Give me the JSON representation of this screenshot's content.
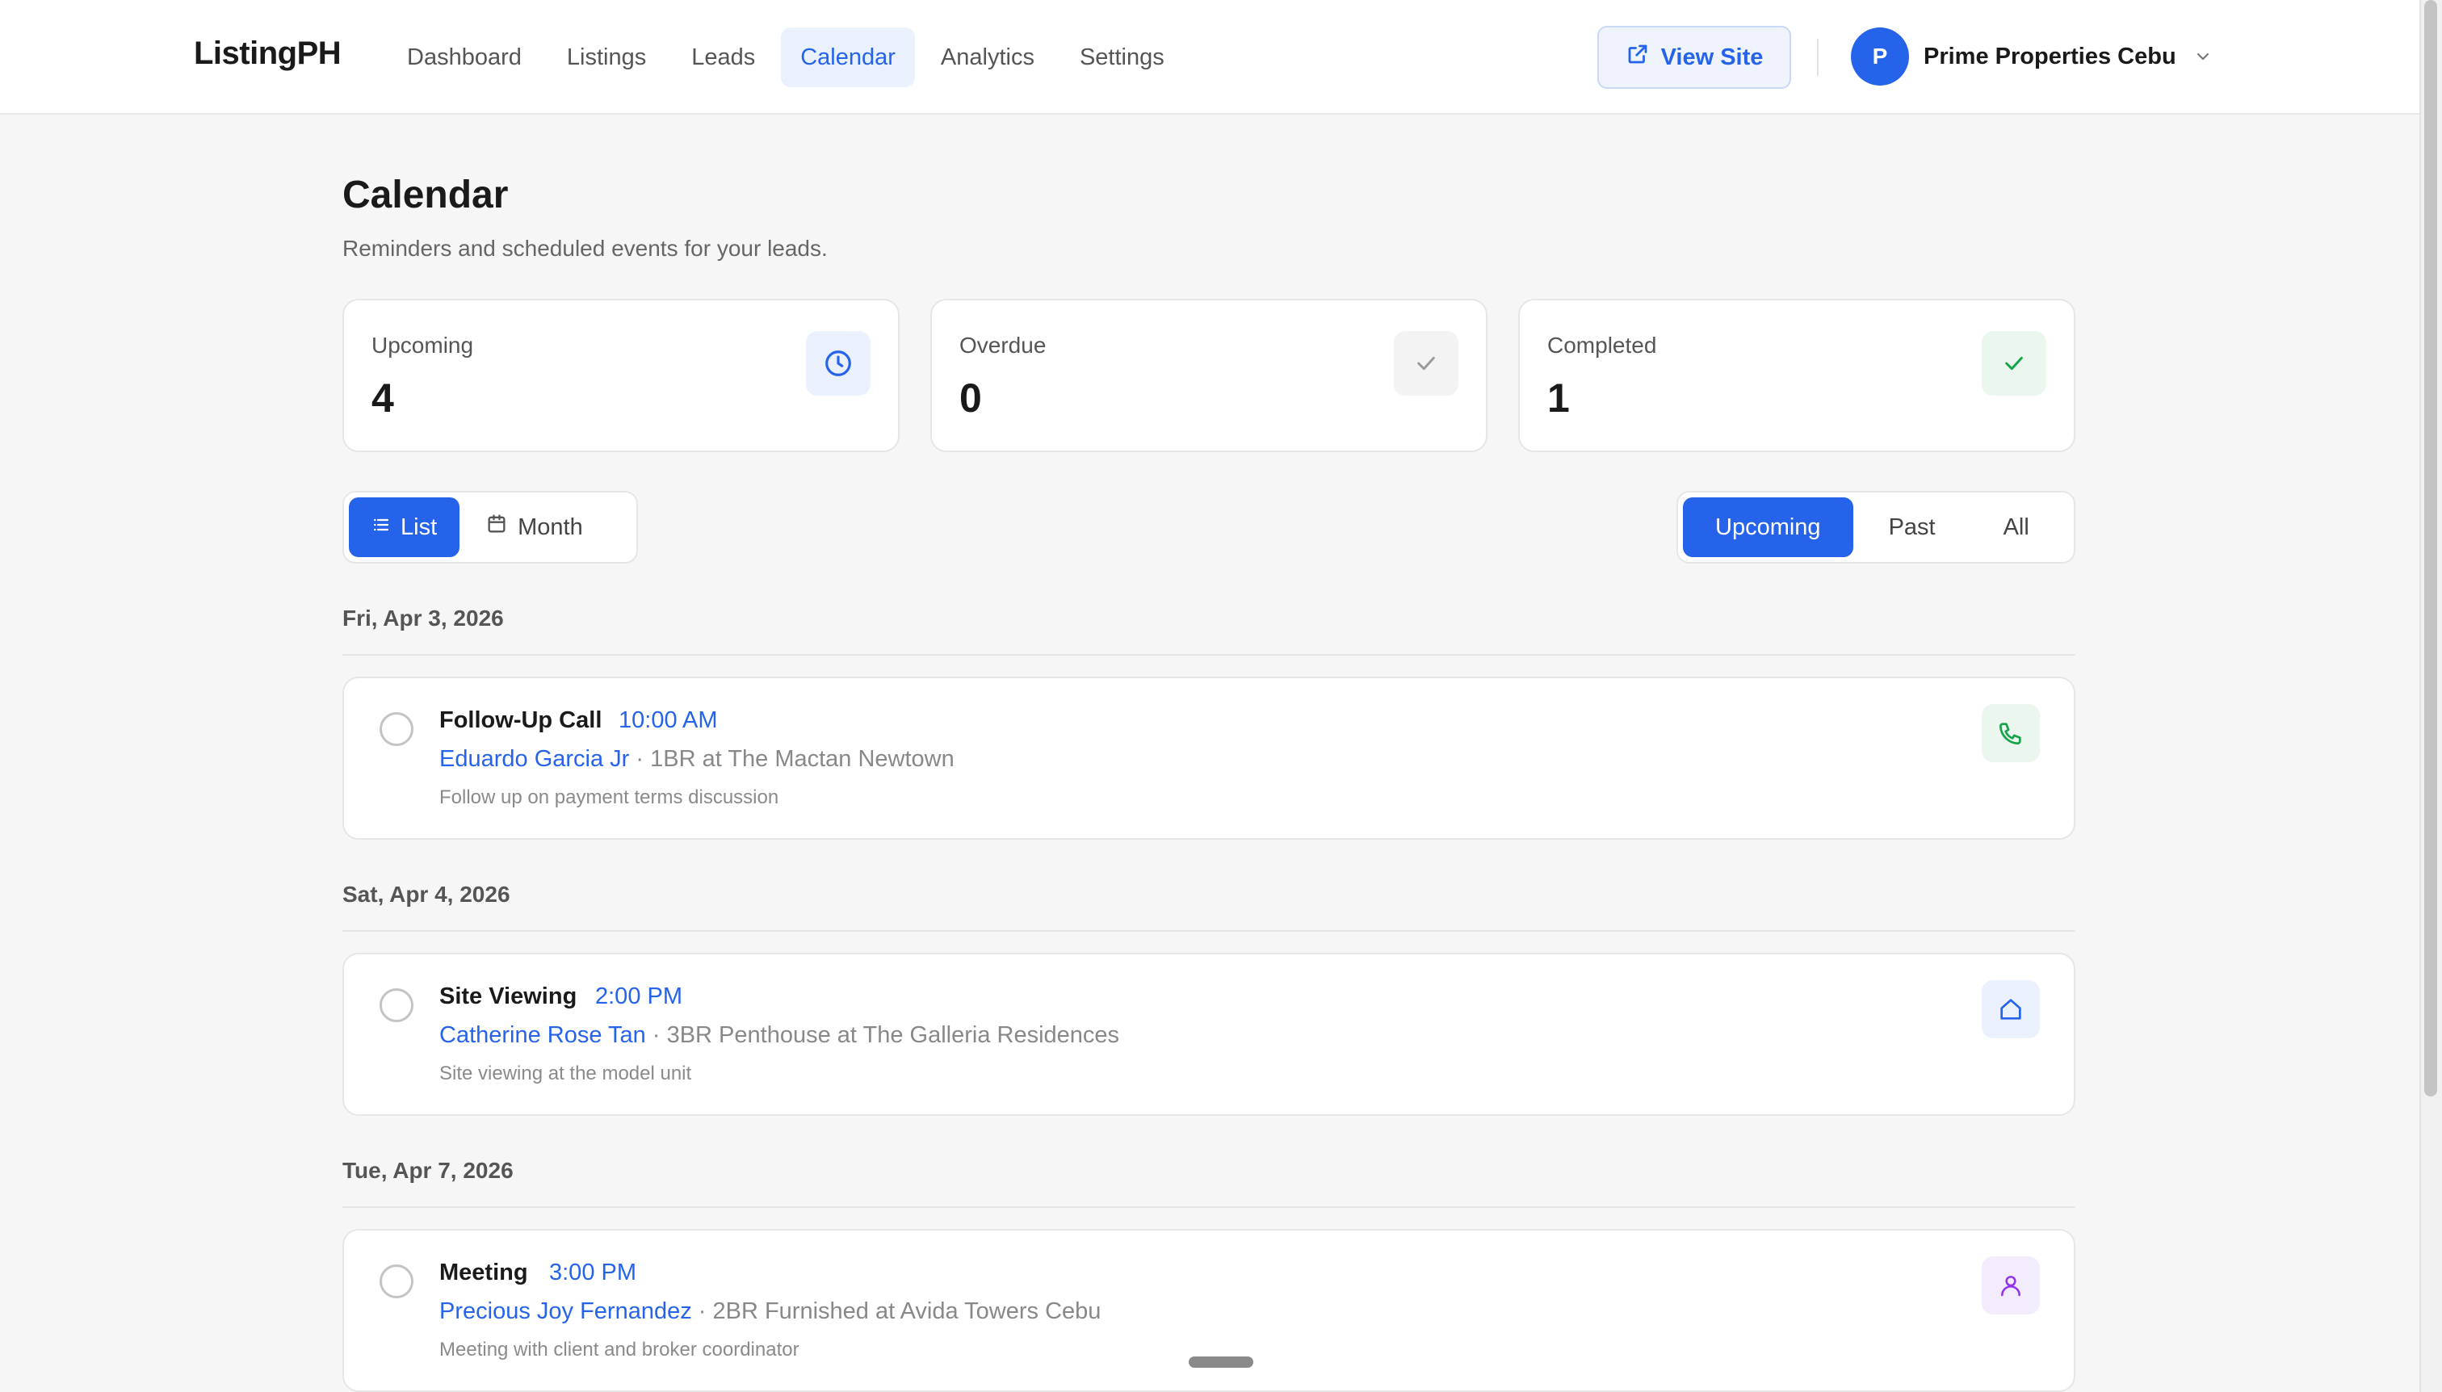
{
  "header": {
    "brand": "ListingPH",
    "nav": [
      {
        "label": "Dashboard",
        "active": false
      },
      {
        "label": "Listings",
        "active": false
      },
      {
        "label": "Leads",
        "active": false
      },
      {
        "label": "Calendar",
        "active": true
      },
      {
        "label": "Analytics",
        "active": false
      },
      {
        "label": "Settings",
        "active": false
      }
    ],
    "view_site_label": "View Site",
    "account": {
      "initial": "P",
      "name": "Prime Properties Cebu"
    }
  },
  "page": {
    "title": "Calendar",
    "subtitle": "Reminders and scheduled events for your leads."
  },
  "stats": [
    {
      "label": "Upcoming",
      "value": "4",
      "icon": "clock-icon",
      "color": "#2563eb",
      "bg": "#eaf1fd"
    },
    {
      "label": "Overdue",
      "value": "0",
      "icon": "check-icon",
      "color": "#9a9a9a",
      "bg": "#f3f3f3"
    },
    {
      "label": "Completed",
      "value": "1",
      "icon": "check-icon",
      "color": "#16a34a",
      "bg": "#eaf6ee"
    }
  ],
  "view_toggle": {
    "list": "List",
    "month": "Month",
    "selected": "List"
  },
  "filter_toggle": {
    "options": [
      "Upcoming",
      "Past",
      "All"
    ],
    "selected": "Upcoming"
  },
  "groups": [
    {
      "date": "Fri, Apr 3, 2026",
      "event": {
        "title": "Follow-Up Call",
        "time": "10:00 AM",
        "lead": "Eduardo Garcia Jr",
        "listing": " · 1BR at The Mactan Newtown",
        "note": "Follow up on payment terms discussion",
        "icon": "phone-icon",
        "icon_color": "#16a34a",
        "icon_bg": "#eaf6ee"
      }
    },
    {
      "date": "Sat, Apr 4, 2026",
      "event": {
        "title": "Site Viewing",
        "time": "2:00 PM",
        "lead": "Catherine Rose Tan",
        "listing": " · 3BR Penthouse at The Galleria Residences",
        "note": "Site viewing at the model unit",
        "icon": "home-icon",
        "icon_color": "#2563eb",
        "icon_bg": "#eaf1fd"
      }
    },
    {
      "date": "Tue, Apr 7, 2026",
      "event": {
        "title": "Meeting",
        "time": "3:00 PM",
        "lead": "Precious Joy Fernandez",
        "listing": " · 2BR Furnished at Avida Towers Cebu",
        "note": "Meeting with client and broker coordinator",
        "icon": "person-icon",
        "icon_color": "#9333ea",
        "icon_bg": "#f3ecfd"
      }
    }
  ]
}
